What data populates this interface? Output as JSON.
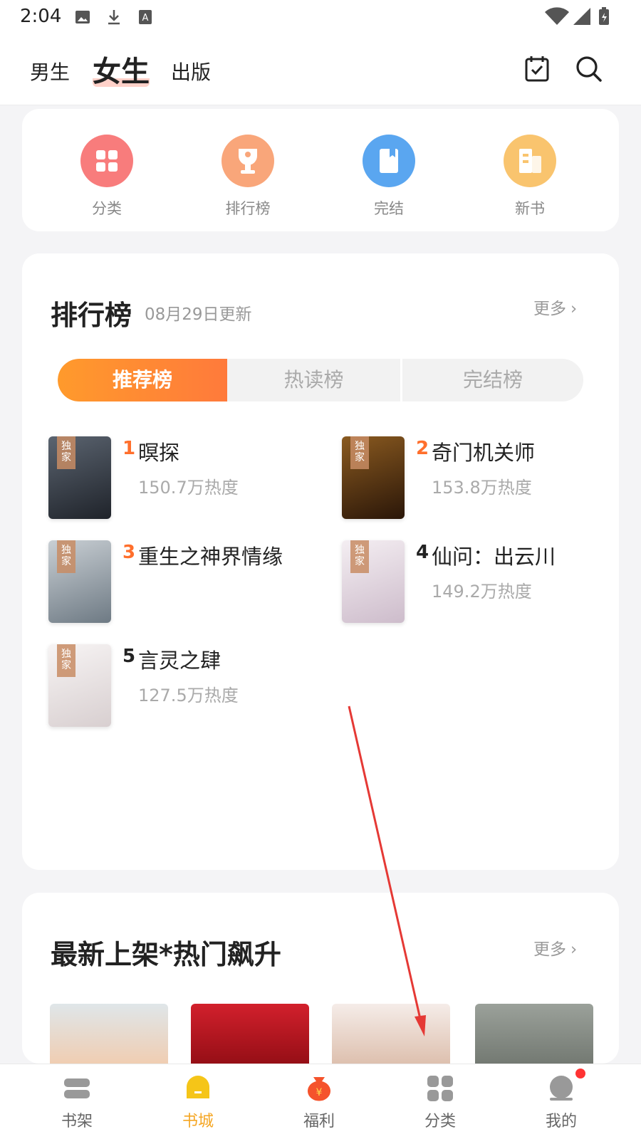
{
  "status_bar": {
    "time": "2:04"
  },
  "header": {
    "tabs": [
      {
        "label": "男生",
        "active": false
      },
      {
        "label": "女生",
        "active": true
      },
      {
        "label": "出版",
        "active": false
      }
    ]
  },
  "quick_links": [
    {
      "label": "分类",
      "icon": "grid-icon",
      "color": "#f87c7c"
    },
    {
      "label": "排行榜",
      "icon": "trophy-icon",
      "color": "#f9a67a"
    },
    {
      "label": "完结",
      "icon": "book-icon",
      "color": "#5aa6f0"
    },
    {
      "label": "新书",
      "icon": "building-icon",
      "color": "#f9c46e"
    }
  ],
  "ranking": {
    "title": "排行榜",
    "updated": "08月29日更新",
    "more": "更多",
    "tabs": [
      {
        "label": "推荐榜",
        "active": true
      },
      {
        "label": "热读榜",
        "active": false
      },
      {
        "label": "完结榜",
        "active": false
      }
    ],
    "exclusive_badge": "独家",
    "books": [
      {
        "rank": "1",
        "title": "暝探",
        "heat": "150.7万热度",
        "cover_color": "#3a3f48"
      },
      {
        "rank": "2",
        "title": "奇门机关师",
        "heat": "153.8万热度",
        "cover_color": "#4a2a16"
      },
      {
        "rank": "3",
        "title": "重生之神界情缘",
        "heat": "",
        "cover_color": "#9aa4ad"
      },
      {
        "rank": "4",
        "title": "仙问：出云川",
        "heat": "149.2万热度",
        "cover_color": "#e8dfe6"
      },
      {
        "rank": "5",
        "title": "言灵之肆",
        "heat": "127.5万热度",
        "cover_color": "#f1eeee"
      }
    ]
  },
  "new_releases": {
    "title": "最新上架*热门飙升",
    "more": "更多",
    "covers": [
      "#dfe6e9",
      "#b3121c",
      "#efe6e2",
      "#8a8f88"
    ]
  },
  "bottom_nav": [
    {
      "label": "书架",
      "icon": "bookshelf-icon",
      "active": false
    },
    {
      "label": "书城",
      "icon": "bookstore-icon",
      "active": true
    },
    {
      "label": "福利",
      "icon": "bonus-icon",
      "active": false
    },
    {
      "label": "分类",
      "icon": "category-icon",
      "active": false
    },
    {
      "label": "我的",
      "icon": "profile-icon",
      "active": false
    }
  ]
}
